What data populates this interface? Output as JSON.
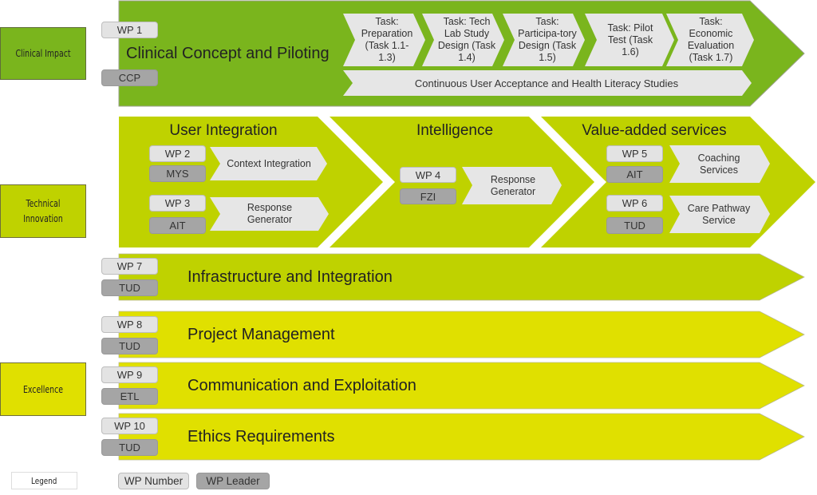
{
  "colors": {
    "clinical": "#7ab51d",
    "technical": "#bfd200",
    "excellence": "#e0e000",
    "task_fill": "#e6e6e6",
    "wp_number": "#e3e3e3",
    "wp_leader": "#a5a5a5"
  },
  "categories": [
    {
      "label": "Clinical Impact"
    },
    {
      "label": "Technical Innovation"
    },
    {
      "label": "Excellence"
    }
  ],
  "wp1": {
    "number": "WP 1",
    "leader": "CCP",
    "title": "Clinical Concept and Piloting",
    "tasks": [
      {
        "label": "Task: Preparation (Task 1.1-1.3)"
      },
      {
        "label": "Task: Tech Lab Study Design (Task 1.4)"
      },
      {
        "label": "Task: Participa-tory Design (Task 1.5)"
      },
      {
        "label": "Task: Pilot Test (Task 1.6)"
      },
      {
        "label": "Task: Economic Evaluation (Task 1.7)"
      }
    ],
    "continuous_task": "Continuous User Acceptance and Health Literacy Studies"
  },
  "technical": {
    "groups": [
      {
        "title": "User Integration"
      },
      {
        "title": "Intelligence"
      },
      {
        "title": "Value-added services"
      }
    ],
    "wps": [
      {
        "number": "WP 2",
        "leader": "MYS",
        "task": "Context Integration"
      },
      {
        "number": "WP 3",
        "leader": "AIT",
        "task": "Response Generator"
      },
      {
        "number": "WP 4",
        "leader": "FZI",
        "task": "Response Generator"
      },
      {
        "number": "WP 5",
        "leader": "AIT",
        "task": "Coaching Services"
      },
      {
        "number": "WP 6",
        "leader": "TUD",
        "task": "Care Pathway Service"
      }
    ]
  },
  "bars": [
    {
      "number": "WP 7",
      "leader": "TUD",
      "title": "Infrastructure and Integration"
    },
    {
      "number": "WP 8",
      "leader": "TUD",
      "title": "Project Management"
    },
    {
      "number": "WP 9",
      "leader": "ETL",
      "title": "Communication and Exploitation"
    },
    {
      "number": "WP 10",
      "leader": "TUD",
      "title": "Ethics Requirements"
    }
  ],
  "legend": {
    "label": "Legend",
    "wp_number": "WP Number",
    "wp_leader": "WP Leader"
  }
}
